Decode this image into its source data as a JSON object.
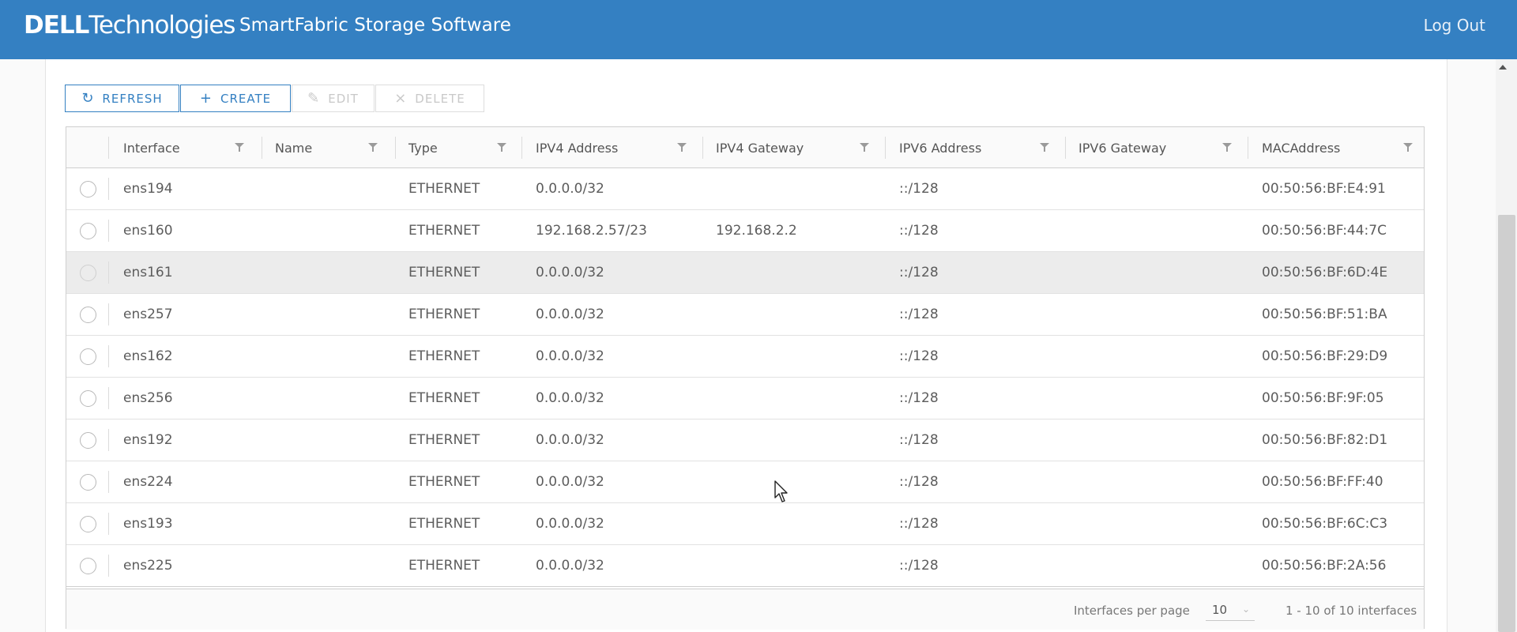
{
  "header": {
    "brand_bold": "DELL",
    "brand_light": "Technologies",
    "app_title": "SmartFabric Storage Software",
    "logout_label": "Log Out"
  },
  "toolbar": {
    "refresh_label": "REFRESH",
    "create_label": "CREATE",
    "edit_label": "EDIT",
    "delete_label": "DELETE"
  },
  "table": {
    "columns": [
      "Interface",
      "Name",
      "Type",
      "IPV4 Address",
      "IPV4 Gateway",
      "IPV6 Address",
      "IPV6 Gateway",
      "MACAddress"
    ],
    "rows": [
      {
        "interface": "ens194",
        "name": "",
        "type": "ETHERNET",
        "ipv4": "0.0.0.0/32",
        "ipv4_gw": "",
        "ipv6": "::/128",
        "ipv6_gw": "",
        "mac": "00:50:56:BF:E4:91"
      },
      {
        "interface": "ens160",
        "name": "",
        "type": "ETHERNET",
        "ipv4": "192.168.2.57/23",
        "ipv4_gw": "192.168.2.2",
        "ipv6": "::/128",
        "ipv6_gw": "",
        "mac": "00:50:56:BF:44:7C"
      },
      {
        "interface": "ens161",
        "name": "",
        "type": "ETHERNET",
        "ipv4": "0.0.0.0/32",
        "ipv4_gw": "",
        "ipv6": "::/128",
        "ipv6_gw": "",
        "mac": "00:50:56:BF:6D:4E"
      },
      {
        "interface": "ens257",
        "name": "",
        "type": "ETHERNET",
        "ipv4": "0.0.0.0/32",
        "ipv4_gw": "",
        "ipv6": "::/128",
        "ipv6_gw": "",
        "mac": "00:50:56:BF:51:BA"
      },
      {
        "interface": "ens162",
        "name": "",
        "type": "ETHERNET",
        "ipv4": "0.0.0.0/32",
        "ipv4_gw": "",
        "ipv6": "::/128",
        "ipv6_gw": "",
        "mac": "00:50:56:BF:29:D9"
      },
      {
        "interface": "ens256",
        "name": "",
        "type": "ETHERNET",
        "ipv4": "0.0.0.0/32",
        "ipv4_gw": "",
        "ipv6": "::/128",
        "ipv6_gw": "",
        "mac": "00:50:56:BF:9F:05"
      },
      {
        "interface": "ens192",
        "name": "",
        "type": "ETHERNET",
        "ipv4": "0.0.0.0/32",
        "ipv4_gw": "",
        "ipv6": "::/128",
        "ipv6_gw": "",
        "mac": "00:50:56:BF:82:D1"
      },
      {
        "interface": "ens224",
        "name": "",
        "type": "ETHERNET",
        "ipv4": "0.0.0.0/32",
        "ipv4_gw": "",
        "ipv6": "::/128",
        "ipv6_gw": "",
        "mac": "00:50:56:BF:FF:40"
      },
      {
        "interface": "ens193",
        "name": "",
        "type": "ETHERNET",
        "ipv4": "0.0.0.0/32",
        "ipv4_gw": "",
        "ipv6": "::/128",
        "ipv6_gw": "",
        "mac": "00:50:56:BF:6C:C3"
      },
      {
        "interface": "ens225",
        "name": "",
        "type": "ETHERNET",
        "ipv4": "0.0.0.0/32",
        "ipv4_gw": "",
        "ipv6": "::/128",
        "ipv6_gw": "",
        "mac": "00:50:56:BF:2A:56"
      }
    ]
  },
  "footer": {
    "per_page_label": "Interfaces per page",
    "per_page_value": "10",
    "range_label": "1 - 10 of 10 interfaces"
  }
}
